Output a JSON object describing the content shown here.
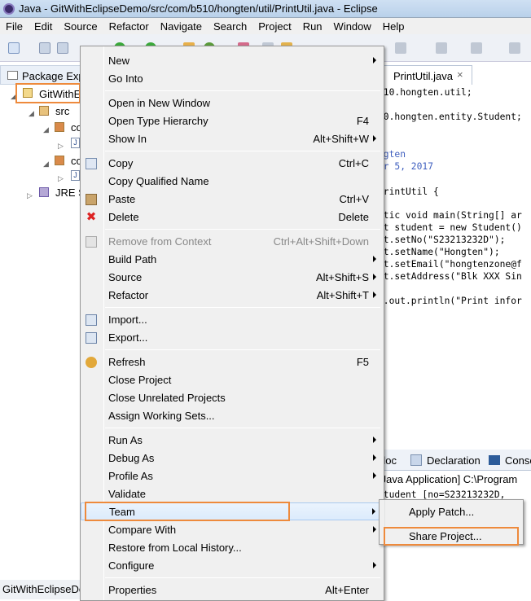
{
  "window": {
    "title": "Java - GitWithEclipseDemo/src/com/b510/hongten/util/PrintUtil.java - Eclipse"
  },
  "menubar": [
    "File",
    "Edit",
    "Source",
    "Refactor",
    "Navigate",
    "Search",
    "Project",
    "Run",
    "Window",
    "Help"
  ],
  "explorer": {
    "tab_label": "Package Exp",
    "project": "GitWithE",
    "src": "src",
    "pkg1": "co",
    "pkg2": "co",
    "jre": "JRE S",
    "file_icon": "J"
  },
  "status": {
    "text": "GitWithEclipseDe"
  },
  "editor": {
    "tab_label": "PrintUtil.java",
    "close": "×",
    "lines": [
      {
        "text": "510.hongten.util;"
      },
      {
        "text": "10.hongten.entity.Student;"
      },
      {
        "text": "ngten"
      },
      {
        "text": "ar 5, 2017"
      },
      {
        "text": "PrintUtil {"
      },
      {
        "text": "atic void main(String[] ar"
      },
      {
        "text": "nt student = new Student()"
      },
      {
        "text": "nt.setNo(\"S23213232D\");"
      },
      {
        "text": "nt.setName(\"Hongten\");"
      },
      {
        "text": "nt.setEmail(\"hongtenzone@f"
      },
      {
        "text": "nt.setAddress(\"Blk XXX Sin"
      },
      {
        "text": "m.out.println(\"Print infor"
      }
    ]
  },
  "bottom": {
    "tab_doc": "doc",
    "tab_declaration": "Declaration",
    "tab_console": "Conso",
    "line1": "[Java Application] C:\\Program",
    "line2": "Student [no=S23213232D,"
  },
  "context_menu": {
    "items": [
      {
        "label": "New",
        "shortcut": "",
        "submenu": true
      },
      {
        "label": "Go Into",
        "shortcut": ""
      },
      {
        "label": "Open in New Window",
        "shortcut": ""
      },
      {
        "label": "Open Type Hierarchy",
        "shortcut": "F4"
      },
      {
        "label": "Show In",
        "shortcut": "Alt+Shift+W",
        "submenu": true
      },
      {
        "label": "Copy",
        "shortcut": "Ctrl+C"
      },
      {
        "label": "Copy Qualified Name",
        "shortcut": ""
      },
      {
        "label": "Paste",
        "shortcut": "Ctrl+V"
      },
      {
        "label": "Delete",
        "shortcut": "Delete"
      },
      {
        "label": "Remove from Context",
        "shortcut": "Ctrl+Alt+Shift+Down",
        "disabled": true
      },
      {
        "label": "Build Path",
        "shortcut": "",
        "submenu": true
      },
      {
        "label": "Source",
        "shortcut": "Alt+Shift+S",
        "submenu": true
      },
      {
        "label": "Refactor",
        "shortcut": "Alt+Shift+T",
        "submenu": true
      },
      {
        "label": "Import...",
        "shortcut": ""
      },
      {
        "label": "Export...",
        "shortcut": ""
      },
      {
        "label": "Refresh",
        "shortcut": "F5"
      },
      {
        "label": "Close Project",
        "shortcut": ""
      },
      {
        "label": "Close Unrelated Projects",
        "shortcut": ""
      },
      {
        "label": "Assign Working Sets...",
        "shortcut": ""
      },
      {
        "label": "Run As",
        "shortcut": "",
        "submenu": true
      },
      {
        "label": "Debug As",
        "shortcut": "",
        "submenu": true
      },
      {
        "label": "Profile As",
        "shortcut": "",
        "submenu": true
      },
      {
        "label": "Validate",
        "shortcut": ""
      },
      {
        "label": "Team",
        "shortcut": "",
        "submenu": true
      },
      {
        "label": "Compare With",
        "shortcut": "",
        "submenu": true
      },
      {
        "label": "Restore from Local History...",
        "shortcut": ""
      },
      {
        "label": "Configure",
        "shortcut": "",
        "submenu": true
      },
      {
        "label": "Properties",
        "shortcut": "Alt+Enter"
      }
    ]
  },
  "team_submenu": {
    "items": [
      {
        "label": "Apply Patch..."
      },
      {
        "label": "Share Project..."
      }
    ]
  },
  "colors": {
    "highlight": "#ee8a3c",
    "selection": "#dcebfc",
    "accent": "#3875d7"
  }
}
